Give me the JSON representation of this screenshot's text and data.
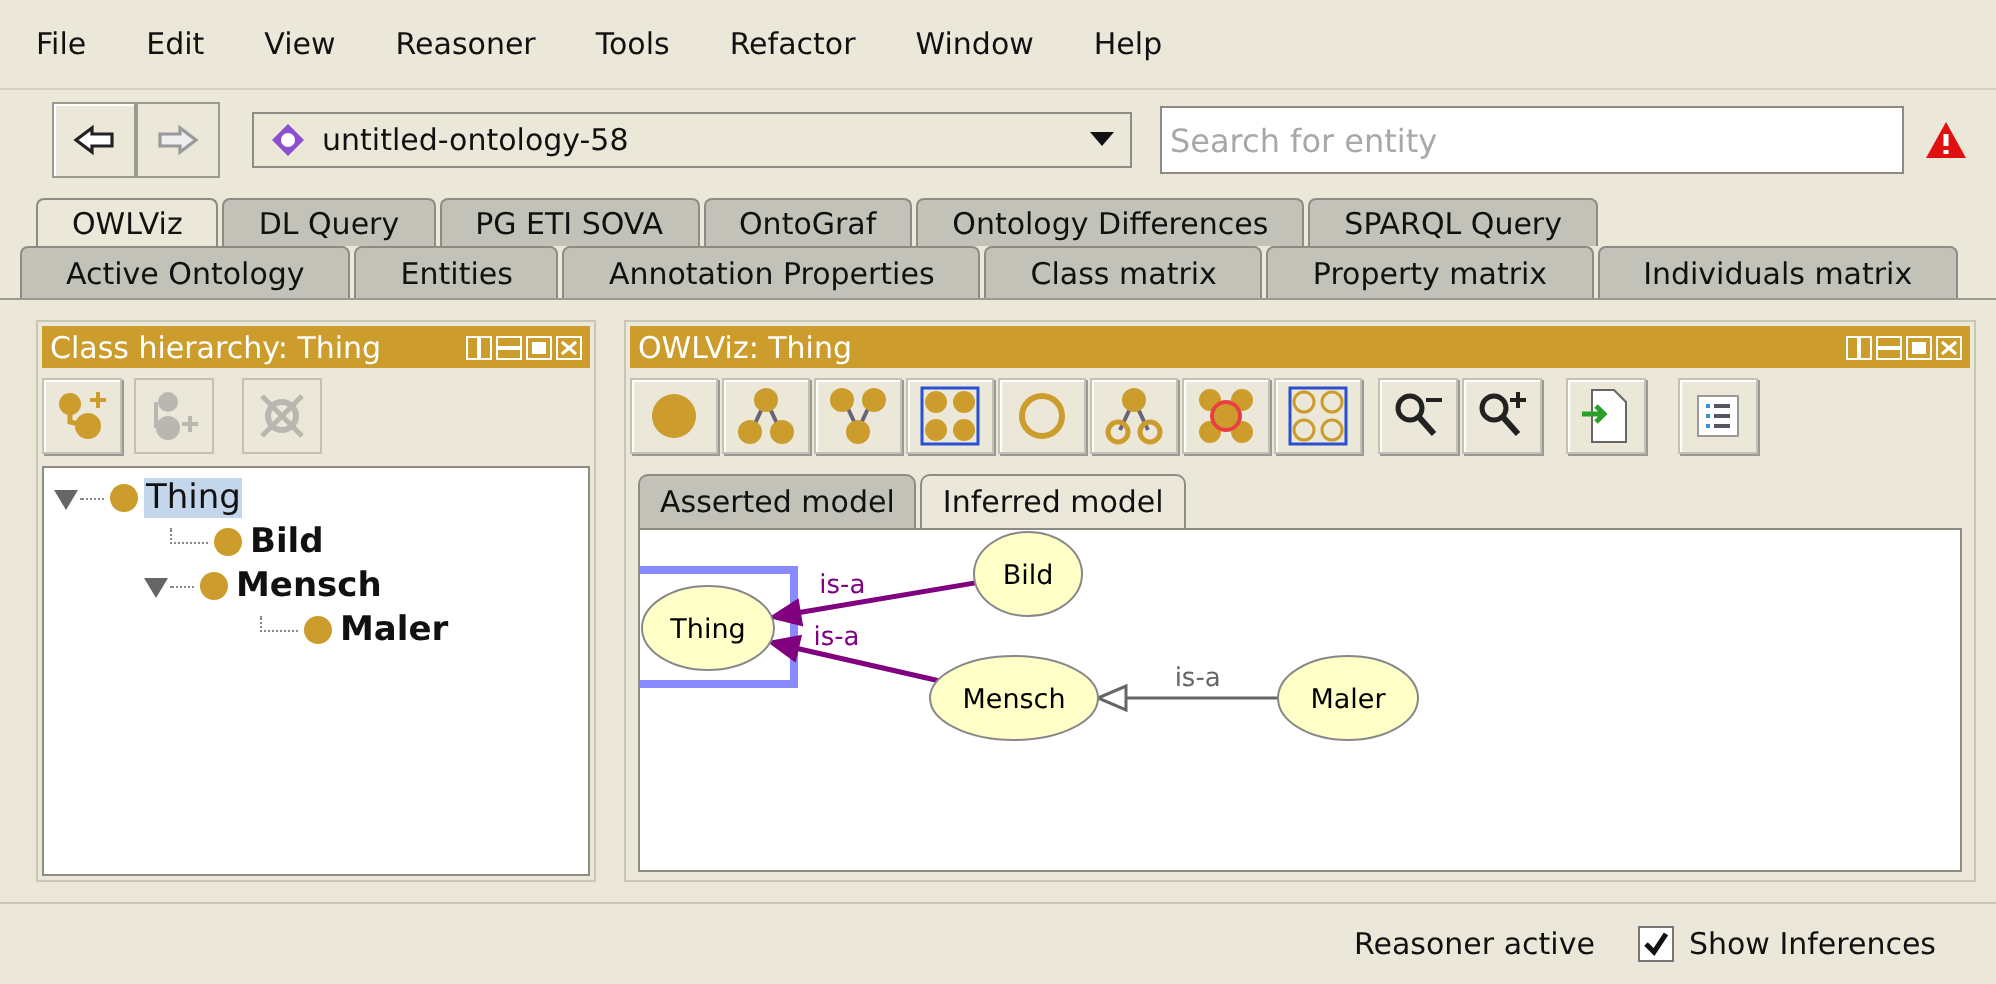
{
  "menu": [
    "File",
    "Edit",
    "View",
    "Reasoner",
    "Tools",
    "Refactor",
    "Window",
    "Help"
  ],
  "navigation": {
    "back": {
      "disabled": false
    },
    "forward": {
      "disabled": true
    }
  },
  "ontology_selector": {
    "value": "untitled-ontology-58"
  },
  "search": {
    "placeholder": "Search for entity"
  },
  "tab_rows": [
    [
      {
        "label": "OWLViz",
        "selected": true
      },
      {
        "label": "DL Query",
        "selected": false
      },
      {
        "label": "PG ETI SOVA",
        "selected": false
      },
      {
        "label": "OntoGraf",
        "selected": false
      },
      {
        "label": "Ontology Differences",
        "selected": false
      },
      {
        "label": "SPARQL Query",
        "selected": false
      }
    ],
    [
      {
        "label": "Active Ontology",
        "selected": false
      },
      {
        "label": "Entities",
        "selected": false
      },
      {
        "label": "Annotation Properties",
        "selected": false
      },
      {
        "label": "Class matrix",
        "selected": false
      },
      {
        "label": "Property matrix",
        "selected": false
      },
      {
        "label": "Individuals matrix",
        "selected": false
      }
    ]
  ],
  "class_hierarchy": {
    "title": "Class hierarchy: Thing",
    "toolbar": [
      {
        "disabled": false
      },
      {
        "disabled": true
      },
      {
        "disabled": true
      }
    ],
    "tree": [
      {
        "label": "Thing",
        "selected": true,
        "bold": false,
        "expanded": true,
        "children": [
          {
            "label": "Bild",
            "selected": false,
            "bold": true
          },
          {
            "label": "Mensch",
            "selected": false,
            "bold": true,
            "expanded": true,
            "children": [
              {
                "label": "Maler",
                "selected": false,
                "bold": true
              }
            ]
          }
        ]
      }
    ]
  },
  "owlviz": {
    "title": "OWLViz: Thing",
    "model_tabs": [
      {
        "label": "Asserted model",
        "selected": false
      },
      {
        "label": "Inferred model",
        "selected": true
      }
    ],
    "graph": {
      "nodes": [
        {
          "label": "Thing",
          "selected": true
        },
        {
          "label": "Bild",
          "selected": false
        },
        {
          "label": "Mensch",
          "selected": false
        },
        {
          "label": "Maler",
          "selected": false
        }
      ],
      "edges": [
        {
          "label": "is-a",
          "kind": "inferred"
        },
        {
          "label": "is-a",
          "kind": "inferred"
        },
        {
          "label": "is-a",
          "kind": "asserted"
        }
      ]
    }
  },
  "status_bar": {
    "reasoner": "Reasoner active",
    "show_inferences": {
      "label": "Show Inferences",
      "checked": true
    }
  }
}
